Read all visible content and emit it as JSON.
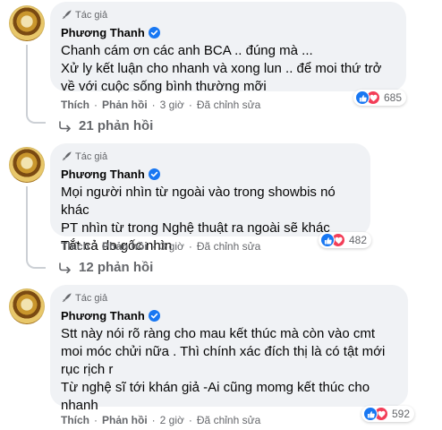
{
  "comments": [
    {
      "badge": "Tác giả",
      "author": "Phương Thanh",
      "text": "Chanh cám ơn các anh BCA .. đúng mà ...\nXử ly kết luận cho nhanh và xong lun .. để moi thứ trở về với cuộc sống bình thường mỡi",
      "reaction_count": "685",
      "like_label": "Thích",
      "reply_label": "Phản hồi",
      "time": "3 giờ",
      "edited": "Đã chỉnh sửa",
      "replies_label": "21 phản hồi"
    },
    {
      "badge": "Tác giả",
      "author": "Phương Thanh",
      "text": "Mọi người nhìn từ ngoài vào trong showbis nó khác\nPT nhìn từ trong Nghệ thuật ra ngoài sẽ khác\nTắt cả do gốc nhìn",
      "reaction_count": "482",
      "like_label": "Thích",
      "reply_label": "Phản hồi",
      "time": "3 giờ",
      "edited": "Đã chỉnh sửa",
      "replies_label": "12 phản hồi"
    },
    {
      "badge": "Tác giả",
      "author": "Phương Thanh",
      "text": "Stt này nói rõ ràng cho mau kết thúc mà còn vào cmt moi móc chửi nữa . Thì chính xác đích thị là có tật mới rục rịch r\nTừ nghệ sĩ tới khán giả -Ai cũng momg kết thúc cho nhanh",
      "reaction_count": "592",
      "like_label": "Thích",
      "reply_label": "Phản hồi",
      "time": "2 giờ",
      "edited": "Đã chỉnh sửa"
    }
  ],
  "colors": {
    "like": "#1877f2",
    "love": "#f33e58",
    "verified": "#1877f2",
    "bubble": "#f0f2f5",
    "meta": "#65676b"
  }
}
